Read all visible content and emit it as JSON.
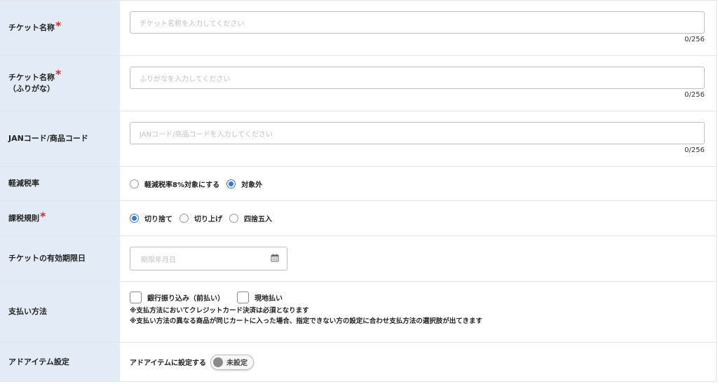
{
  "fields": {
    "ticket_name": {
      "label": "チケット名称",
      "required_mark": "*",
      "placeholder": "チケット名称を入力してください",
      "counter": "0/256"
    },
    "ticket_kana": {
      "label_line1": "チケット名称",
      "label_line2": "（ふりがな）",
      "required_mark": "*",
      "placeholder": "ふりがなを入力してください",
      "counter": "0/256"
    },
    "jan_code": {
      "label": "JANコード/商品コード",
      "placeholder": "JANコード/商品コードを入力してください",
      "counter": "0/256"
    },
    "reduced_tax": {
      "label": "軽減税率",
      "options": [
        {
          "label": "軽減税率8%対象にする",
          "selected": false
        },
        {
          "label": "対象外",
          "selected": true
        }
      ]
    },
    "tax_rule": {
      "label": "課税規則",
      "required_mark": "*",
      "options": [
        {
          "label": "切り捨て",
          "selected": true
        },
        {
          "label": "切り上げ",
          "selected": false
        },
        {
          "label": "四捨五入",
          "selected": false
        }
      ]
    },
    "expiry": {
      "label": "チケットの有効期限日",
      "placeholder": "期限年月日",
      "icon": "calendar-icon"
    },
    "payment": {
      "label": "支払い方法",
      "options": [
        {
          "label": "銀行振り込み（前払い）",
          "checked": false
        },
        {
          "label": "現地払い",
          "checked": false
        }
      ],
      "note1": "※支払方法においてクレジットカード決済は必須となります",
      "note2": "※支払い方法の異なる商品が同じカートに入った場合、指定できない方の設定に合わせ支払方法の選択肢が出てきます"
    },
    "add_item": {
      "label": "アドアイテム設定",
      "text": "アドアイテムに設定する",
      "toggle_label": "未設定"
    }
  },
  "colors": {
    "label_bg": "#e3ecf6",
    "required": "#e0262b",
    "radio_accent": "#3b78c9",
    "border": "#e5e5e5"
  }
}
